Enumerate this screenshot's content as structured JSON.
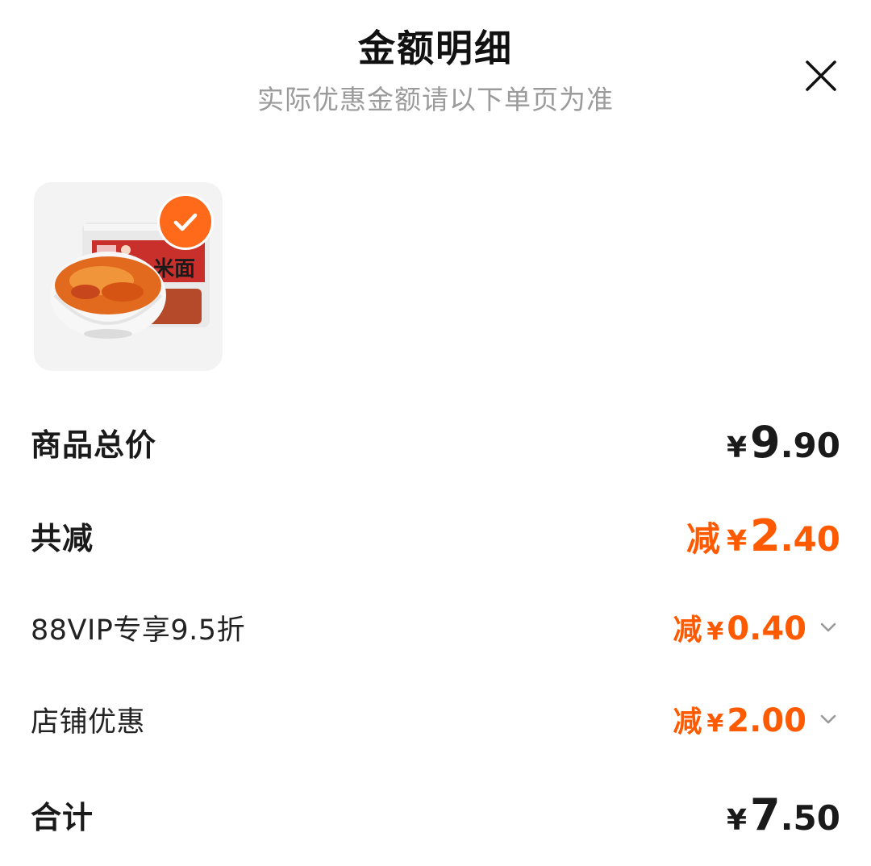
{
  "header": {
    "title": "金额明细",
    "subtitle": "实际优惠金额请以下单页为准"
  },
  "product": {
    "package_text": "米面",
    "selected": true
  },
  "rows": {
    "total": {
      "label": "商品总价",
      "currency": "¥",
      "integer": "9",
      "decimal": ".90"
    },
    "reduced": {
      "label": "共减",
      "prefix": "减",
      "currency": "¥",
      "integer": "2",
      "decimal": ".40"
    },
    "vip": {
      "label": "88VIP专享9.5折",
      "prefix": "减",
      "currency": "¥",
      "amount": "0.40"
    },
    "shop": {
      "label": "店铺优惠",
      "prefix": "减",
      "currency": "¥",
      "amount": "2.00"
    },
    "sum": {
      "label": "合计",
      "currency": "¥",
      "integer": "7",
      "decimal": ".50"
    }
  },
  "colors": {
    "accent": "#ff5a00",
    "badge": "#ff6a1a",
    "subtitle": "#9b9b9b"
  },
  "icons": {
    "close": "close-icon",
    "check": "check-icon",
    "chevron": "chevron-down-icon"
  }
}
